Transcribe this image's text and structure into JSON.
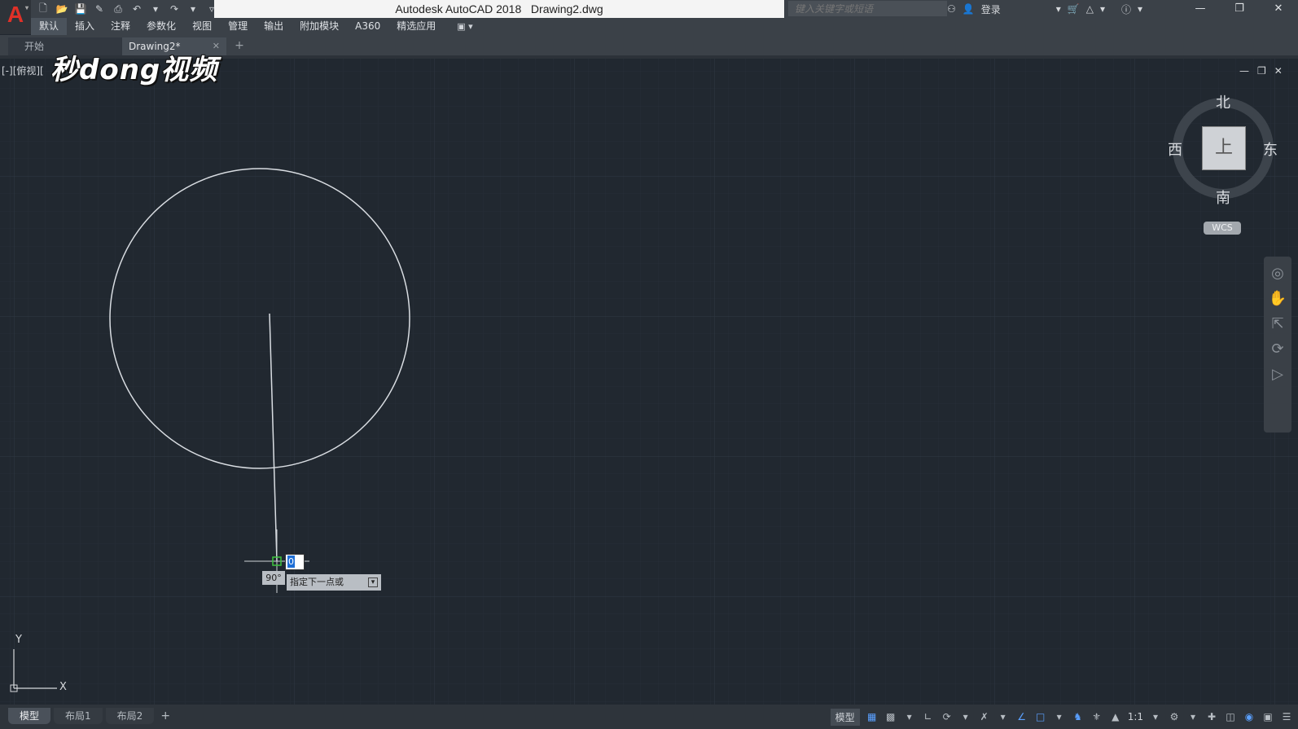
{
  "app": {
    "title": "Autodesk AutoCAD 2018",
    "document": "Drawing2.dwg",
    "logo_letter": "A"
  },
  "search": {
    "placeholder": "键入关键字或短语"
  },
  "account": {
    "login_label": "登录"
  },
  "menu": {
    "items": [
      "默认",
      "插入",
      "注释",
      "参数化",
      "视图",
      "管理",
      "输出",
      "附加模块",
      "A360",
      "精选应用"
    ],
    "active_index": 0
  },
  "tabs": {
    "start_label": "开始",
    "drawing_label": "Drawing2*",
    "add_label": "+"
  },
  "viewport": {
    "label": "[-][俯视][",
    "watermark": "秒dong视频"
  },
  "viewcube": {
    "north": "北",
    "south": "南",
    "east": "东",
    "west": "西",
    "face": "上",
    "wcs": "WCS"
  },
  "cursor": {
    "angle": "90°",
    "prompt": "指定下一点或",
    "input_value": "0"
  },
  "ucs": {
    "x_label": "X",
    "y_label": "Y"
  },
  "layout_tabs": {
    "items": [
      "模型",
      "布局1",
      "布局2"
    ],
    "active_index": 0,
    "add_label": "+"
  },
  "statusbar": {
    "model_label": "模型",
    "scale": "1:1"
  },
  "colors": {
    "canvas": "#212830",
    "logo_red": "#e03128",
    "selection_blue": "#1f6fd6",
    "snap_green": "#3ec43e"
  }
}
